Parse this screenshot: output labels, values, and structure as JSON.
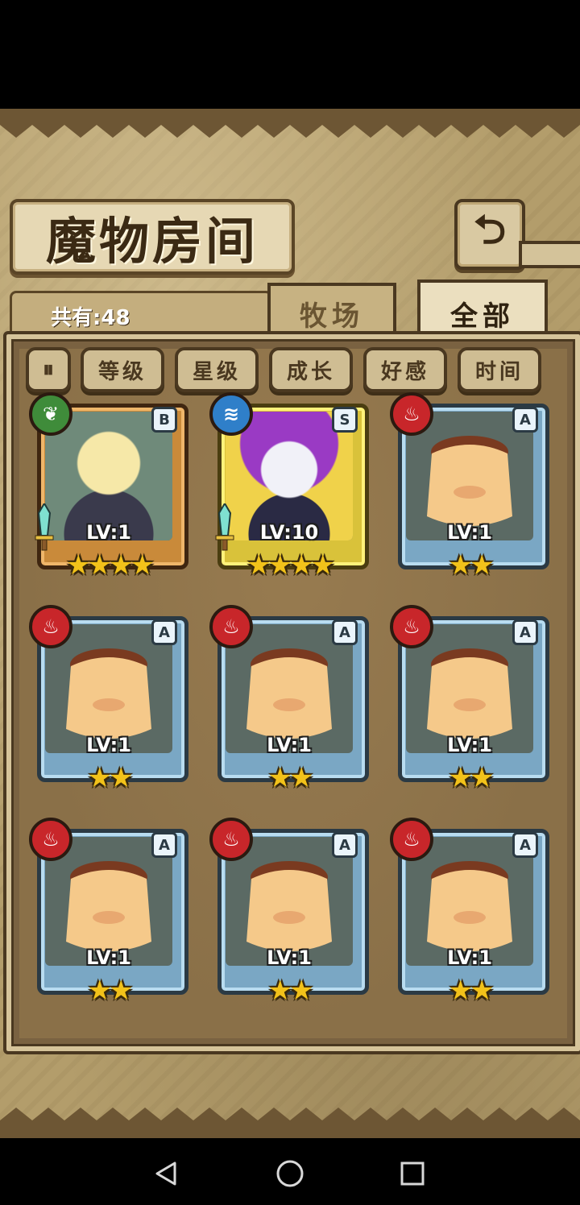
{
  "header": {
    "title": "魔物房间",
    "back_icon": "back-arrow-icon"
  },
  "summary": {
    "count_label": "共有:48"
  },
  "tabs": [
    {
      "label": "牧场",
      "active": false
    },
    {
      "label": "全部",
      "active": true
    }
  ],
  "filters": {
    "sort_icon": "sort-toggle-icon",
    "items": [
      "等级",
      "星级",
      "成长",
      "好感",
      "时间"
    ]
  },
  "monsters": [
    {
      "element": "wood",
      "rank": "B",
      "level": "LV:1",
      "stars": "★★★★",
      "frame": "bronze",
      "weapon": true
    },
    {
      "element": "water",
      "rank": "S",
      "level": "LV:10",
      "stars": "★★★★",
      "frame": "gold",
      "weapon": true
    },
    {
      "element": "fire",
      "rank": "A",
      "level": "LV:1",
      "stars": "★★",
      "frame": "blue",
      "weapon": false
    },
    {
      "element": "fire",
      "rank": "A",
      "level": "LV:1",
      "stars": "★★",
      "frame": "blue",
      "weapon": false
    },
    {
      "element": "fire",
      "rank": "A",
      "level": "LV:1",
      "stars": "★★",
      "frame": "blue",
      "weapon": false
    },
    {
      "element": "fire",
      "rank": "A",
      "level": "LV:1",
      "stars": "★★",
      "frame": "blue",
      "weapon": false
    },
    {
      "element": "fire",
      "rank": "A",
      "level": "LV:1",
      "stars": "★★",
      "frame": "blue",
      "weapon": false
    },
    {
      "element": "fire",
      "rank": "A",
      "level": "LV:1",
      "stars": "★★",
      "frame": "blue",
      "weapon": false
    },
    {
      "element": "fire",
      "rank": "A",
      "level": "LV:1",
      "stars": "★★",
      "frame": "blue",
      "weapon": false
    }
  ],
  "nav": {
    "back": "nav-back-icon",
    "home": "nav-home-icon",
    "recents": "nav-recents-icon"
  }
}
